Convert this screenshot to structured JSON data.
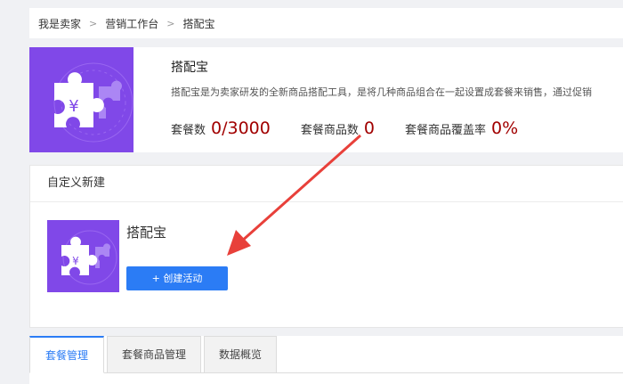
{
  "breadcrumb": {
    "items": [
      "我是卖家",
      "营销工作台",
      "搭配宝"
    ],
    "separator": ">"
  },
  "tool": {
    "title": "搭配宝",
    "description": "搭配宝是为卖家研发的全新商品搭配工具，是将几种商品组合在一起设置成套餐来销售，通过促销",
    "logo_symbol": "¥",
    "logo_icon": "puzzle-icon",
    "stats": [
      {
        "label": "套餐数",
        "value": "0/3000"
      },
      {
        "label": "套餐商品数",
        "value": "0"
      },
      {
        "label": "套餐商品覆盖率",
        "value": "0%"
      }
    ]
  },
  "custom": {
    "section_title": "自定义新建",
    "item_name": "搭配宝",
    "logo_symbol": "¥",
    "create_button": "+ 创建活动"
  },
  "tabs": [
    {
      "label": "套餐管理",
      "active": true
    },
    {
      "label": "套餐商品管理",
      "active": false
    },
    {
      "label": "数据概览",
      "active": false
    }
  ],
  "colors": {
    "accent": "#2b7cf5",
    "logo_purple": "#8048e8",
    "stat_value": "#a10000",
    "annotation_arrow": "#e8403a"
  }
}
